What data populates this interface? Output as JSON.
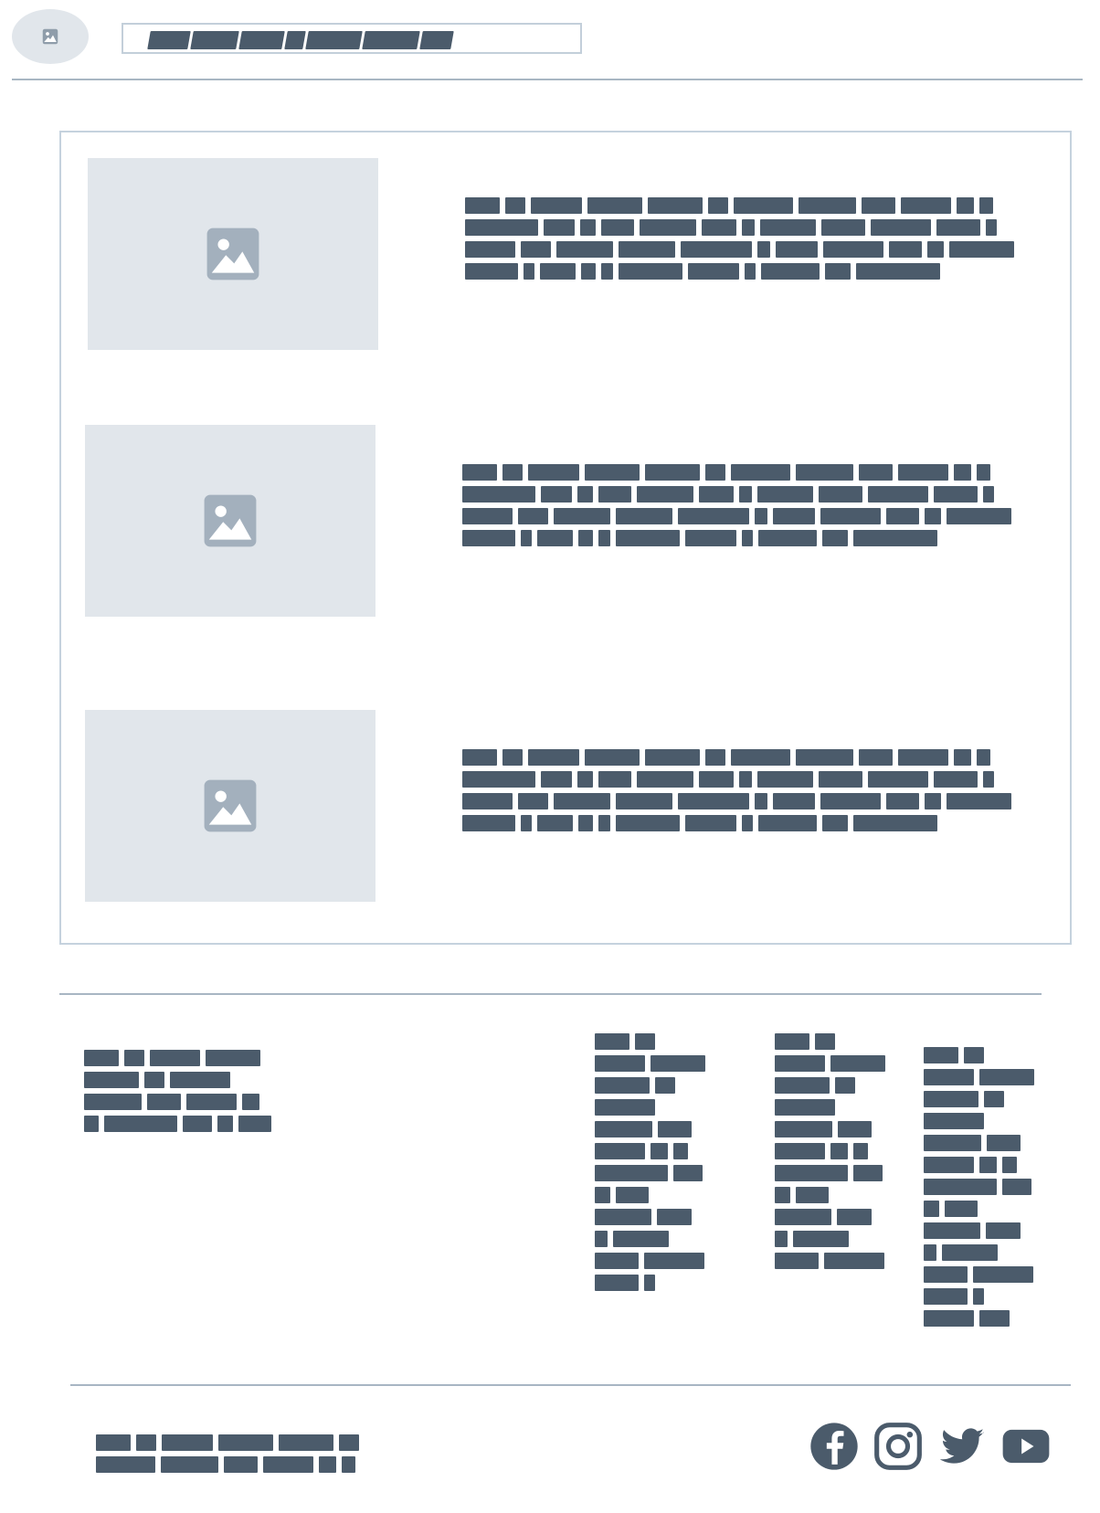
{
  "header": {
    "logo_icon": "image-icon",
    "search_icon": "none"
  },
  "content": {
    "items": [
      {
        "thumb_icon": "image-icon"
      },
      {
        "thumb_icon": "image-icon"
      },
      {
        "thumb_icon": "image-icon"
      }
    ]
  },
  "social": {
    "icons": [
      "facebook-icon",
      "instagram-icon",
      "twitter-icon",
      "youtube-icon"
    ]
  },
  "colors": {
    "text_redaction": "#4b5b6b",
    "placeholder_bg": "#e1e6eb",
    "placeholder_icon": "#a3b0bd",
    "divider": "#a8b6c3",
    "card_border": "#c5d2de"
  }
}
